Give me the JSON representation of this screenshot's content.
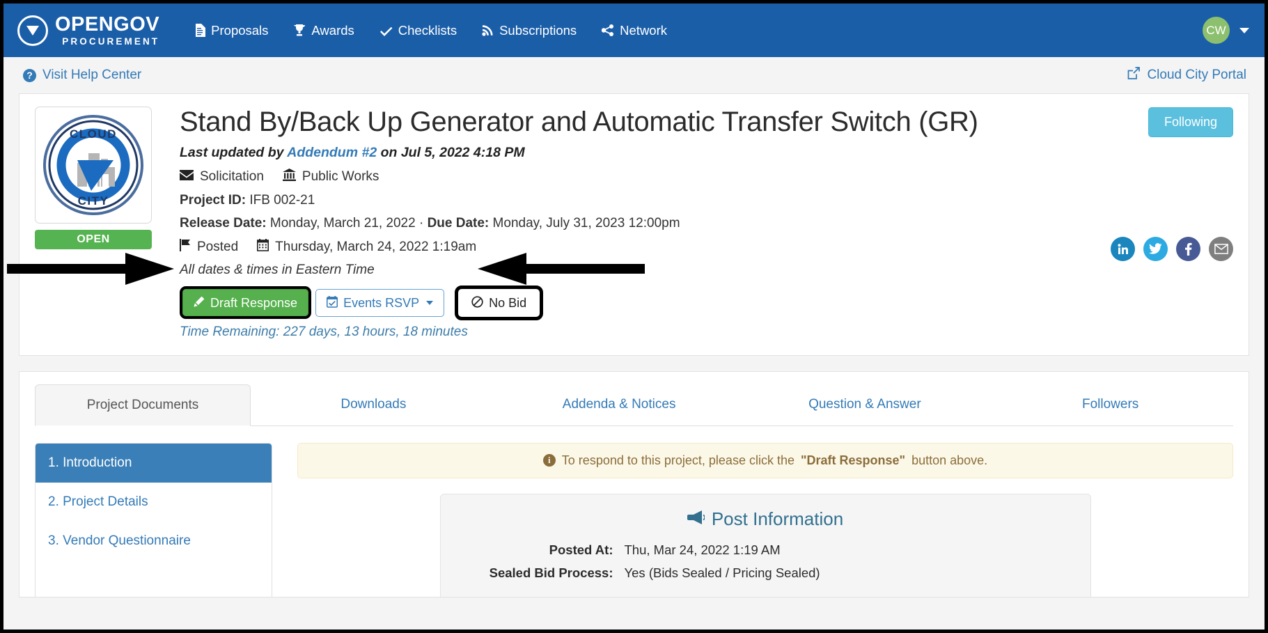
{
  "navbar": {
    "brand_top": "OPENGOV",
    "brand_sub": "PROCUREMENT",
    "links": [
      {
        "label": "Proposals",
        "icon": "document-icon"
      },
      {
        "label": "Awards",
        "icon": "trophy-icon"
      },
      {
        "label": "Checklists",
        "icon": "check-icon"
      },
      {
        "label": "Subscriptions",
        "icon": "rss-icon"
      },
      {
        "label": "Network",
        "icon": "share-icon"
      }
    ],
    "avatar_initials": "CW",
    "accent_color": "#1b5ea8"
  },
  "helpbar": {
    "help_label": "Visit Help Center",
    "portal_label": "Cloud City Portal"
  },
  "project": {
    "title": "Stand By/Back Up Generator and Automatic Transfer Switch (GR)",
    "last_updated_prefix": "Last updated by",
    "last_updated_link": "Addendum #2",
    "last_updated_suffix": "on Jul 5, 2022 4:18 PM",
    "type_label": "Solicitation",
    "department_label": "Public Works",
    "project_id_label": "Project ID:",
    "project_id_value": "IFB 002-21",
    "release_date_label": "Release Date:",
    "release_date_value": "Monday, March 21, 2022",
    "date_separator": "·",
    "due_date_label": "Due Date:",
    "due_date_value": "Monday, July 31, 2023 12:00pm",
    "posted_label": "Posted",
    "posted_value": "Thursday, March 24, 2022 1:19am",
    "timezone_note": "All dates & times in Eastern Time",
    "status_badge": "OPEN",
    "logo_top_text": "CLOUD",
    "logo_bottom_text": "CITY",
    "following_label": "Following",
    "time_remaining": "Time Remaining: 227 days, 13 hours, 18 minutes"
  },
  "actions": {
    "draft_response": "Draft Response",
    "events_rsvp": "Events RSVP",
    "no_bid": "No Bid"
  },
  "social": [
    {
      "name": "linkedin-icon",
      "glyph": "in",
      "color": "#1a86bd"
    },
    {
      "name": "twitter-icon",
      "glyph": "",
      "color": "#2caae1"
    },
    {
      "name": "facebook-icon",
      "glyph": "f",
      "color": "#475a96"
    },
    {
      "name": "email-icon",
      "glyph": "",
      "color": "#7f7f7f"
    }
  ],
  "tabs": [
    {
      "label": "Project Documents",
      "active": true
    },
    {
      "label": "Downloads",
      "active": false
    },
    {
      "label": "Addenda & Notices",
      "active": false
    },
    {
      "label": "Question & Answer",
      "active": false
    },
    {
      "label": "Followers",
      "active": false
    }
  ],
  "side_nav": [
    {
      "label": "1. Introduction",
      "active": true
    },
    {
      "label": "2. Project Details",
      "active": false
    },
    {
      "label": "3. Vendor Questionnaire",
      "active": false
    }
  ],
  "alert": {
    "text_before": "To respond to this project, please click the",
    "text_bold": "\"Draft Response\"",
    "text_after": "button above."
  },
  "post_information": {
    "title": "Post Information",
    "rows": [
      {
        "label": "Posted At:",
        "value": "Thu, Mar 24, 2022 1:19 AM"
      },
      {
        "label": "Sealed Bid Process:",
        "value": "Yes (Bids Sealed / Pricing Sealed)"
      }
    ]
  }
}
